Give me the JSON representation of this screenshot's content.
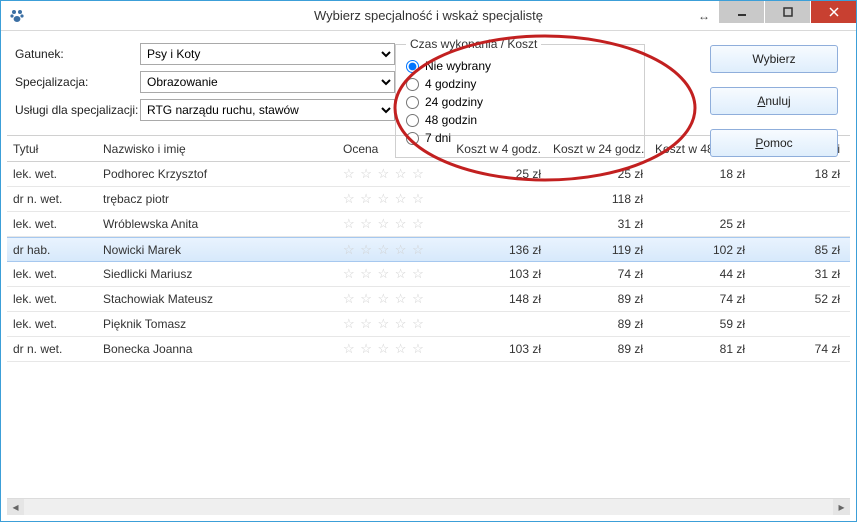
{
  "window": {
    "title": "Wybierz specjalność i wskaż specjalistę"
  },
  "form": {
    "gatunek_label": "Gatunek:",
    "gatunek_value": "Psy i Koty",
    "specjalizacja_label": "Specjalizacja:",
    "specjalizacja_value": "Obrazowanie",
    "uslugi_label": "Usługi dla specjalizacji:",
    "uslugi_value": "RTG narządu ruchu, stawów"
  },
  "radio": {
    "legend": "Czas wykonania / Koszt",
    "options": {
      "none": "Nie wybrany",
      "h4": "4 godziny",
      "h24": "24 godziny",
      "h48": "48 godzin",
      "d7": "7 dni"
    },
    "selected": "none"
  },
  "buttons": {
    "wybierz": "Wybierz",
    "anuluj": "Anuluj",
    "pomoc": "Pomoc",
    "anuluj_prefix": "A",
    "anuluj_rest": "nuluj",
    "pomoc_prefix": "P",
    "pomoc_rest": "omoc"
  },
  "table": {
    "headers": {
      "title": "Tytuł",
      "name": "Nazwisko i imię",
      "rating": "Ocena",
      "k4": "Koszt w 4 godz.",
      "k24": "Koszt w 24 godz.",
      "k48": "Koszt w 48 godz.",
      "k7": "Koszt w 7 dni"
    },
    "rows": [
      {
        "title": "lek. wet.",
        "name": "Podhorec Krzysztof",
        "k4": "25 zł",
        "k24": "25 zł",
        "k48": "18 zł",
        "k7": "18 zł",
        "selected": false
      },
      {
        "title": "dr n. wet.",
        "name": "trębacz piotr",
        "k4": "",
        "k24": "118 zł",
        "k48": "",
        "k7": "",
        "selected": false
      },
      {
        "title": "lek. wet.",
        "name": "Wróblewska Anita",
        "k4": "",
        "k24": "31 zł",
        "k48": "25 zł",
        "k7": "",
        "selected": false
      },
      {
        "title": "dr hab.",
        "name": "Nowicki Marek",
        "k4": "136 zł",
        "k24": "119 zł",
        "k48": "102 zł",
        "k7": "85 zł",
        "selected": true
      },
      {
        "title": "lek. wet.",
        "name": "Siedlicki Mariusz",
        "k4": "103 zł",
        "k24": "74 zł",
        "k48": "44 zł",
        "k7": "31 zł",
        "selected": false
      },
      {
        "title": "lek. wet.",
        "name": "Stachowiak Mateusz",
        "k4": "148 zł",
        "k24": "89 zł",
        "k48": "74 zł",
        "k7": "52 zł",
        "selected": false
      },
      {
        "title": "lek. wet.",
        "name": "Pięknik Tomasz",
        "k4": "",
        "k24": "89 zł",
        "k48": "59 zł",
        "k7": "",
        "selected": false
      },
      {
        "title": "dr n. wet.",
        "name": "Bonecka Joanna",
        "k4": "103 zł",
        "k24": "89 zł",
        "k48": "81 zł",
        "k7": "74 zł",
        "selected": false
      }
    ]
  }
}
